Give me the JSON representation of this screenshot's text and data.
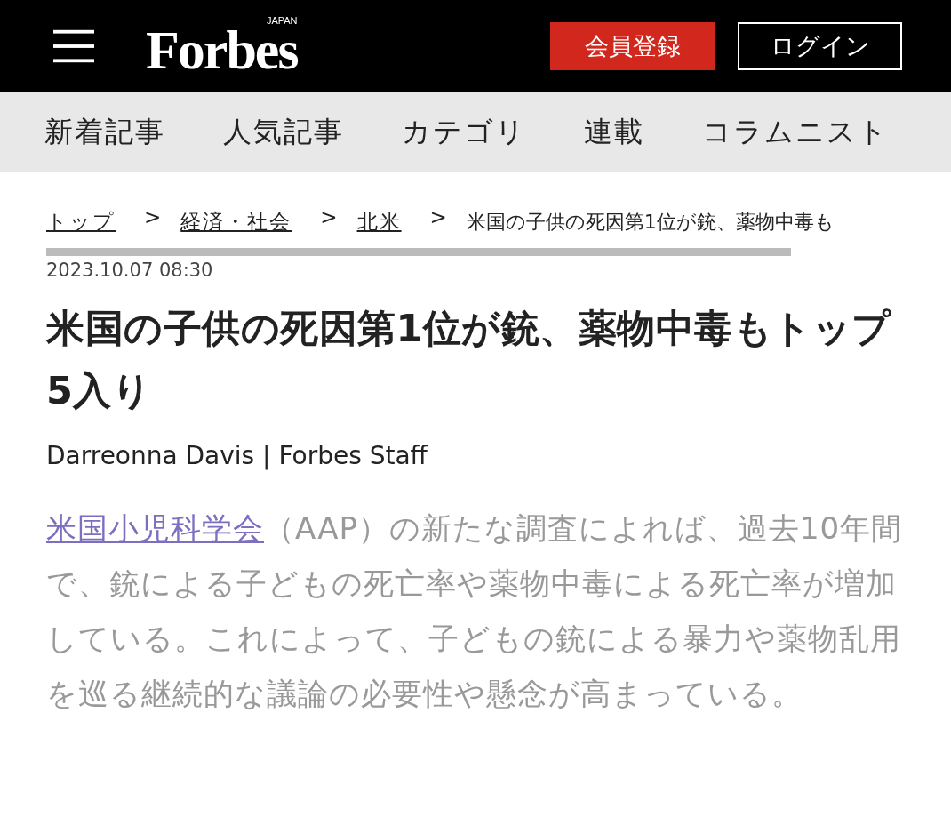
{
  "header": {
    "logo": "Forbes",
    "logo_sub": "JAPAN",
    "buttons": [
      {
        "label": "会員登録",
        "kind": "primary"
      },
      {
        "label": "ログイン",
        "kind": "outline"
      }
    ]
  },
  "nav": [
    "新着記事",
    "人気記事",
    "カテゴリ",
    "連載",
    "コラムニスト"
  ],
  "breadcrumb": {
    "links": [
      "トップ",
      "経済・社会",
      "北米"
    ],
    "separator": ">",
    "current": "米国の子供の死因第1位が銃、薬物中毒も"
  },
  "date": "2023.10.07 08:30",
  "title": "米国の子供の死因第1位が銃、薬物中毒もトップ5入り",
  "byline": "Darreonna Davis | Forbes Staff",
  "body": {
    "link": "米国小児科学会",
    "text": "（AAP）の新たな調査によれば、過去10年間で、銃による子どもの死亡率や薬物中毒による死亡率が増加している。これによって、子どもの銃による暴力や薬物乱用を巡る継続的な議論の必要性や懸念が高まっている。"
  }
}
